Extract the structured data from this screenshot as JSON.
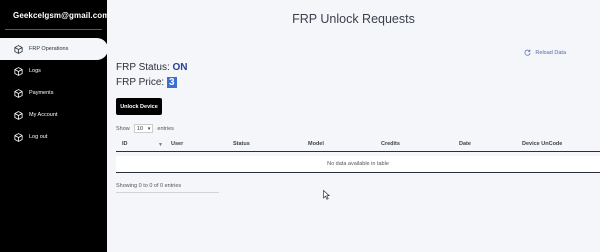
{
  "sidebar": {
    "user": "Geekcelgsm@gmail.com",
    "items": [
      {
        "label": "FRP Operations",
        "icon": "cube-icon",
        "active": true
      },
      {
        "label": "Logs",
        "icon": "cube-icon",
        "active": false
      },
      {
        "label": "Payments",
        "icon": "cube-icon",
        "active": false
      },
      {
        "label": "My Account",
        "icon": "cube-icon",
        "active": false
      },
      {
        "label": "Log out",
        "icon": "cube-icon",
        "active": false
      }
    ]
  },
  "main": {
    "title": "FRP Unlock Requests",
    "reload_label": "Reload Data",
    "frp_status_label": "FRP Status:",
    "frp_status_value": "ON",
    "frp_price_label": "FRP Price:",
    "frp_price_value": "3",
    "unlock_button": "Unlock Device",
    "show_label": "Show",
    "entries_value": "10",
    "entries_label": "entries",
    "table": {
      "columns": [
        "ID",
        "User",
        "Status",
        "Model",
        "Credits",
        "Date",
        "Device UnCode"
      ],
      "empty_text": "No data available in table"
    },
    "info_text": "Showing 0 to 0 of 0 entries"
  },
  "colors": {
    "sidebar_bg": "#000000",
    "page_bg": "#f4f6fa",
    "status_on": "#2b3f8f",
    "price_highlight": "#3b6fd4",
    "link": "#4a6fa5"
  }
}
